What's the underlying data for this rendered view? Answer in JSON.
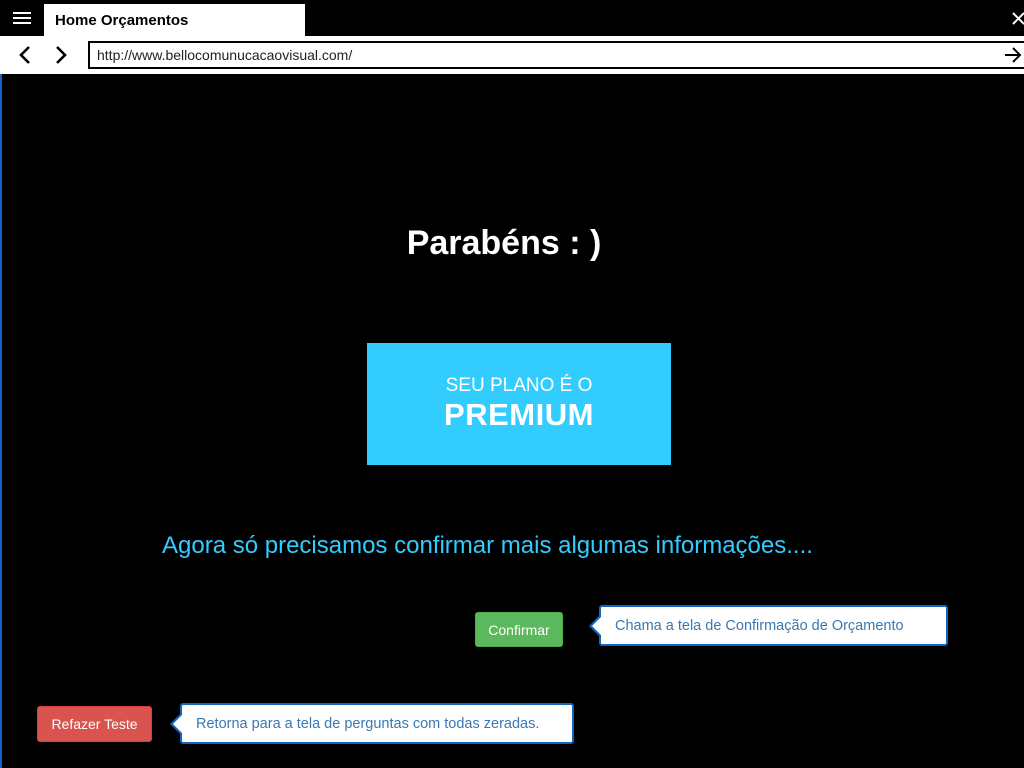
{
  "window": {
    "tab_title": "Home Orçamentos"
  },
  "address_bar": {
    "url": "http://www.bellocomunucacaovisual.com/"
  },
  "page": {
    "heading": "Parabéns : )",
    "plan_box": {
      "line1": "SEU PLANO É O",
      "line2": "PREMIUM"
    },
    "info_line": "Agora só precisamos confirmar mais algumas informações....",
    "confirm_button_label": "Confirmar",
    "confirm_callout": "Chama a tela de Confirmação de Orçamento",
    "redo_button_label": "Refazer Teste",
    "redo_callout": "Retorna para a tela de perguntas com todas zeradas."
  },
  "colors": {
    "background": "#000000",
    "accent_blue": "#33ccff",
    "confirm_green": "#5cb85c",
    "redo_red": "#d9534f",
    "callout_border": "#1565c0",
    "callout_text": "#3a78b4"
  },
  "icons": {
    "menu": "hamburger-menu-icon",
    "close": "close-icon",
    "back": "chevron-left-icon",
    "forward": "chevron-right-icon",
    "go": "arrow-right-icon"
  }
}
